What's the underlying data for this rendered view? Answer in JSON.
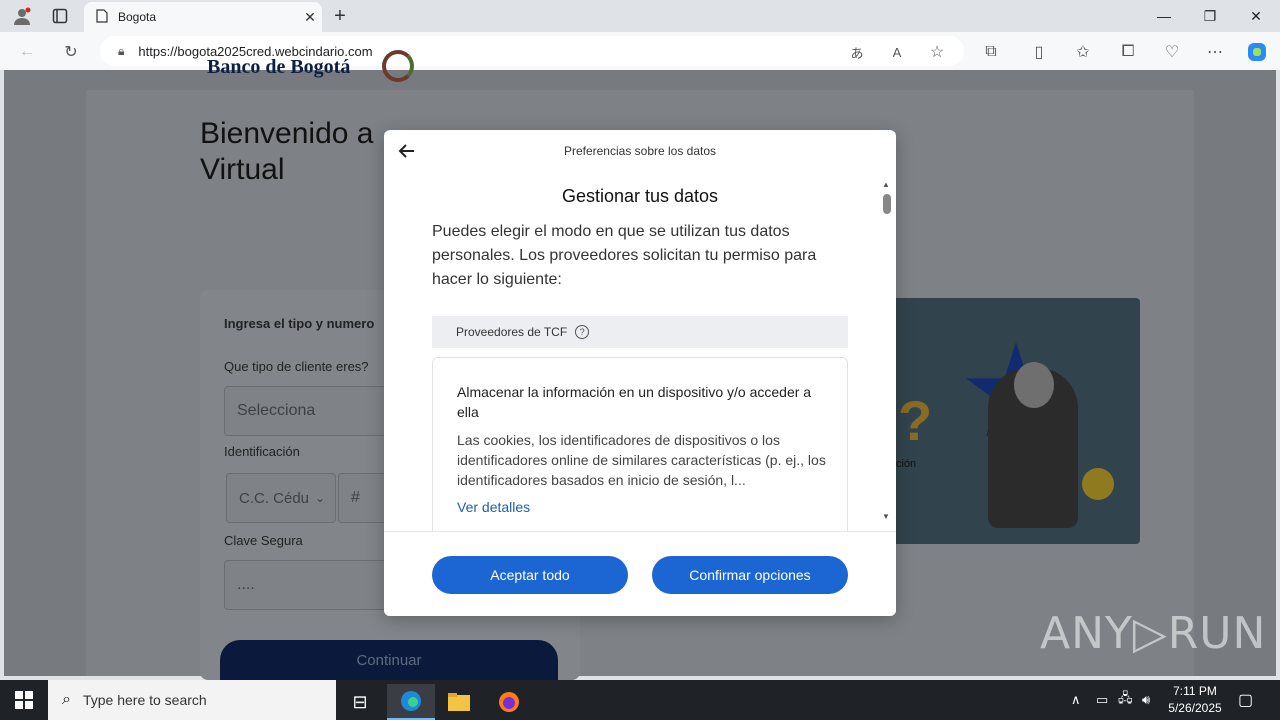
{
  "browser": {
    "tab_title": "Bogota",
    "url_host": "https://bogota2025cred.webcindario.com",
    "icons": [
      "profile-icon",
      "tab-actions-icon",
      "page-icon",
      "close-tab-icon",
      "new-tab-icon",
      "minimize-icon",
      "restore-icon",
      "close-window-icon",
      "back-icon",
      "refresh-icon",
      "lock-icon",
      "translate-icon",
      "read-aloud-icon",
      "favorite-icon",
      "extensions-icon",
      "split-screen-icon",
      "favorites-icon",
      "collections-icon",
      "browser-essentials-icon",
      "more-icon",
      "copilot-icon"
    ]
  },
  "page": {
    "logo_text": "Banco de Bogotá",
    "welcome_line1": "Bienvenido a",
    "welcome_line2": "Virtual",
    "form_title": "Ingresa el tipo y numero",
    "client_type_label": "Que tipo de cliente eres?",
    "client_type_value": "Selecciona",
    "id_label": "Identificación",
    "id_type_value": "C.C. Cédu",
    "id_number_placeholder": "#",
    "password_label": "Clave Segura",
    "password_value": "....",
    "continue_label": "Continuar",
    "promo_text": "ción"
  },
  "modal": {
    "header": "Preferencias sobre los datos",
    "title": "Gestionar tus datos",
    "description": "Puedes elegir el modo en que se utilizan tus datos personales. Los proveedores solicitan tu permiso para hacer lo siguiente:",
    "tcf_label": "Proveedores de TCF",
    "purpose_title": "Almacenar la información en un dispositivo y/o acceder a ella",
    "purpose_body": "Las cookies, los identificadores de dispositivos o los identificadores online de similares características (p. ej., los identificadores basados en inicio de sesión, l...",
    "purpose_link": "Ver detalles",
    "accept_all": "Aceptar todo",
    "confirm_options": "Confirmar opciones",
    "accent_color": "#1c66d4"
  },
  "watermark": "ANY▷RUN",
  "taskbar": {
    "search_placeholder": "Type here to search",
    "time": "7:11 PM",
    "date": "5/26/2025"
  }
}
